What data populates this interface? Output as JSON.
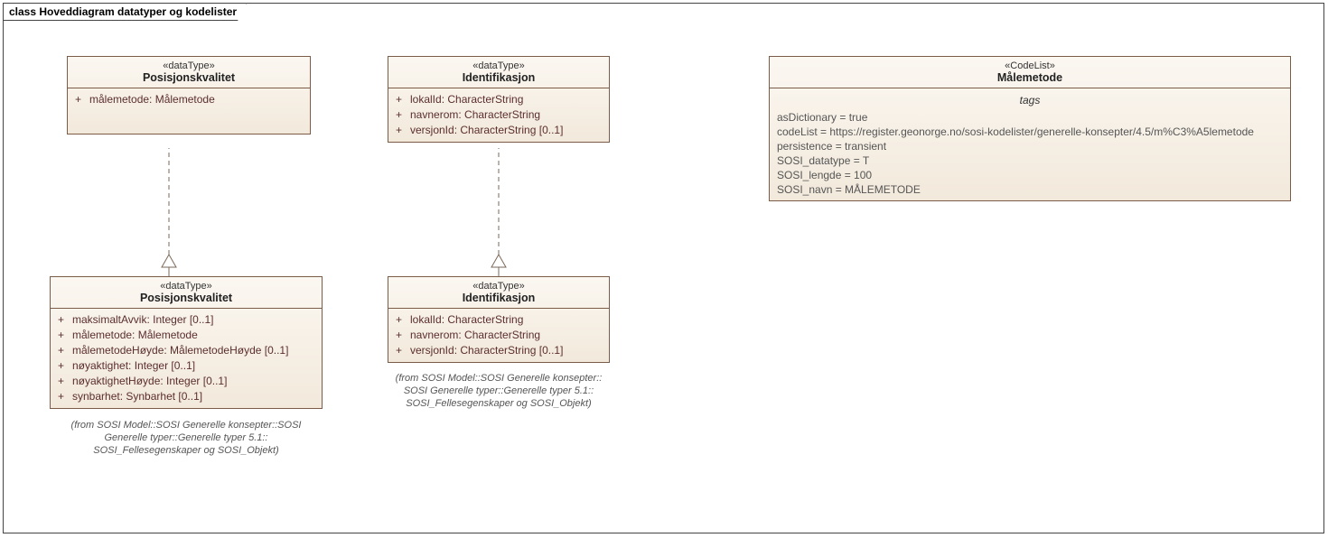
{
  "frame": {
    "title": "class Hoveddiagram datatyper og kodelister"
  },
  "box1": {
    "stereotype": "«dataType»",
    "name": "Posisjonskvalitet",
    "attrs": [
      {
        "vis": "+",
        "text": "målemetode: Målemetode"
      }
    ]
  },
  "box2": {
    "stereotype": "«dataType»",
    "name": "Posisjonskvalitet",
    "attrs": [
      {
        "vis": "+",
        "text": "maksimaltAvvik: Integer [0..1]"
      },
      {
        "vis": "+",
        "text": "målemetode: Målemetode"
      },
      {
        "vis": "+",
        "text": "målemetodeHøyde: MålemetodeHøyde [0..1]"
      },
      {
        "vis": "+",
        "text": "nøyaktighet: Integer [0..1]"
      },
      {
        "vis": "+",
        "text": "nøyaktighetHøyde: Integer [0..1]"
      },
      {
        "vis": "+",
        "text": "synbarhet: Synbarhet [0..1]"
      }
    ],
    "note": [
      "(from SOSI Model::SOSI Generelle konsepter::SOSI",
      "Generelle typer::Generelle typer 5.1::",
      "SOSI_Fellesegenskaper og SOSI_Objekt)"
    ]
  },
  "box3": {
    "stereotype": "«dataType»",
    "name": "Identifikasjon",
    "attrs": [
      {
        "vis": "+",
        "text": "lokalId: CharacterString"
      },
      {
        "vis": "+",
        "text": "navnerom: CharacterString"
      },
      {
        "vis": "+",
        "text": "versjonId: CharacterString [0..1]"
      }
    ]
  },
  "box4": {
    "stereotype": "«dataType»",
    "name": "Identifikasjon",
    "attrs": [
      {
        "vis": "+",
        "text": "lokalId: CharacterString"
      },
      {
        "vis": "+",
        "text": "navnerom: CharacterString"
      },
      {
        "vis": "+",
        "text": "versjonId: CharacterString [0..1]"
      }
    ],
    "note": [
      "(from SOSI Model::SOSI Generelle konsepter::",
      "SOSI Generelle typer::Generelle typer 5.1::",
      "SOSI_Fellesegenskaper og SOSI_Objekt)"
    ]
  },
  "box5": {
    "stereotype": "«CodeList»",
    "name": "Målemetode",
    "tagsLabel": "tags",
    "tags": [
      "asDictionary = true",
      "codeList = https://register.geonorge.no/sosi-kodelister/generelle-konsepter/4.5/m%C3%A5lemetode",
      "persistence = transient",
      "SOSI_datatype = T",
      "SOSI_lengde = 100",
      "SOSI_navn = MÅLEMETODE"
    ]
  }
}
